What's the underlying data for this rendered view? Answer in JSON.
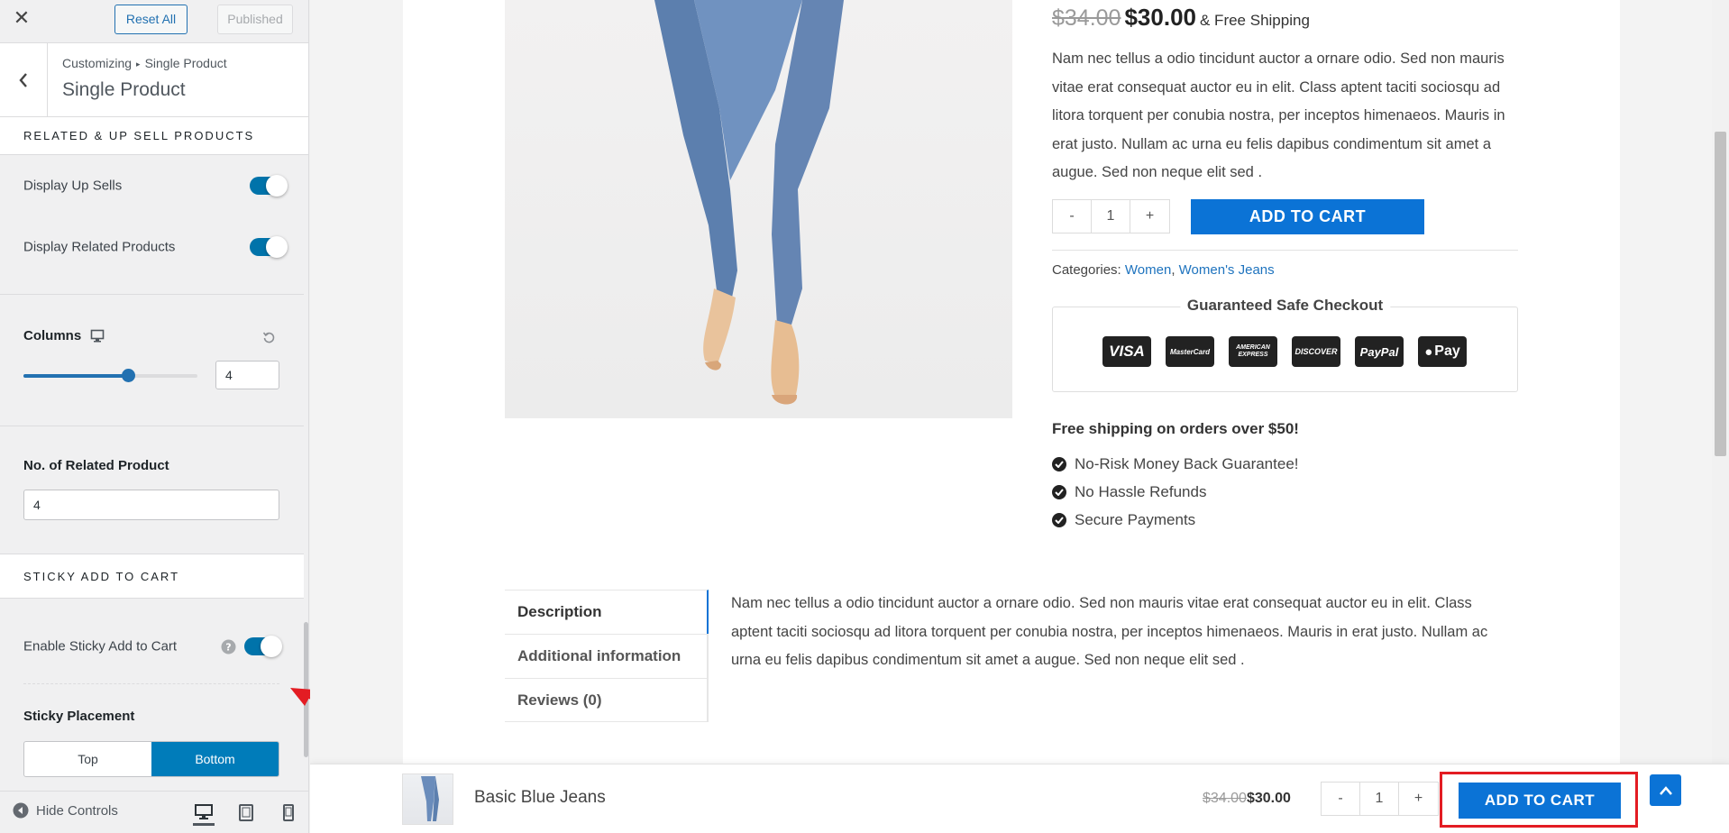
{
  "customizer": {
    "reset_label": "Reset All",
    "published_label": "Published",
    "breadcrumb_root": "Customizing",
    "breadcrumb_sep": "▸",
    "breadcrumb_leaf": "Single Product",
    "section_title": "Single Product",
    "related_group_title": "RELATED & UP SELL PRODUCTS",
    "display_up_sells_label": "Display Up Sells",
    "display_up_sells_on": true,
    "display_related_label": "Display Related Products",
    "display_related_on": true,
    "columns_label": "Columns",
    "columns_value": "4",
    "columns_slider_fraction": 0.6,
    "related_count_label": "No. of Related Product",
    "related_count_value": "4",
    "sticky_group_title": "STICKY ADD TO CART",
    "enable_sticky_label": "Enable Sticky Add to Cart",
    "enable_sticky_on": true,
    "sticky_placement_label": "Sticky Placement",
    "placement_options": [
      "Top",
      "Bottom"
    ],
    "placement_selected": "Bottom",
    "hide_controls_label": "Hide Controls"
  },
  "product": {
    "old_price": "$34.00",
    "new_price": "$30.00",
    "shipping_note": "& Free Shipping",
    "short_description": "Nam nec tellus a odio tincidunt auctor a ornare odio. Sed non mauris vitae erat consequat auctor eu in elit. Class aptent taciti sociosqu ad litora torquent per conubia nostra, per inceptos himenaeos. Mauris in erat justo. Nullam ac urna eu felis dapibus condimentum sit amet a augue. Sed non neque elit sed .",
    "qty_minus": "-",
    "qty_value": "1",
    "qty_plus": "+",
    "add_to_cart": "ADD TO CART",
    "categories_label": "Categories:",
    "categories": [
      "Women",
      "Women's Jeans"
    ],
    "safe_checkout_title": "Guaranteed Safe Checkout",
    "payment_cards": [
      "VISA",
      "MasterCard",
      "AMERICAN EXPRESS",
      "DISCOVER",
      "PayPal",
      "Pay"
    ],
    "free_shipping_heading": "Free shipping on orders over $50!",
    "benefits": [
      "No-Risk Money Back Guarantee!",
      "No Hassle Refunds",
      "Secure Payments"
    ]
  },
  "tabs": {
    "items": [
      "Description",
      "Additional information",
      "Reviews (0)"
    ],
    "active": "Description",
    "description_text": "Nam nec tellus a odio tincidunt auctor a ornare odio. Sed non mauris vitae erat consequat auctor eu in elit. Class aptent taciti sociosqu ad litora torquent per conubia nostra, per inceptos himenaeos. Mauris in erat justo. Nullam ac urna eu felis dapibus condimentum sit amet a augue. Sed non neque elit sed ."
  },
  "sticky_bar": {
    "product_name": "Basic Blue Jeans",
    "old_price": "$34.00",
    "new_price": "$30.00",
    "qty_minus": "-",
    "qty_value": "1",
    "qty_plus": "+",
    "add_to_cart": "ADD TO CART"
  },
  "colors": {
    "accent": "#0b73d6",
    "toggle_on": "#0073aa",
    "highlight": "#e31c23"
  },
  "icons": {
    "close": "close-icon",
    "back": "chevron-left-icon",
    "desktop": "desktop-icon",
    "reset": "reset-icon",
    "help": "help-icon",
    "hide": "collapse-icon",
    "tablet": "tablet-icon",
    "mobile": "mobile-icon",
    "check": "check-circle-icon",
    "to_top": "chevron-up-icon"
  }
}
